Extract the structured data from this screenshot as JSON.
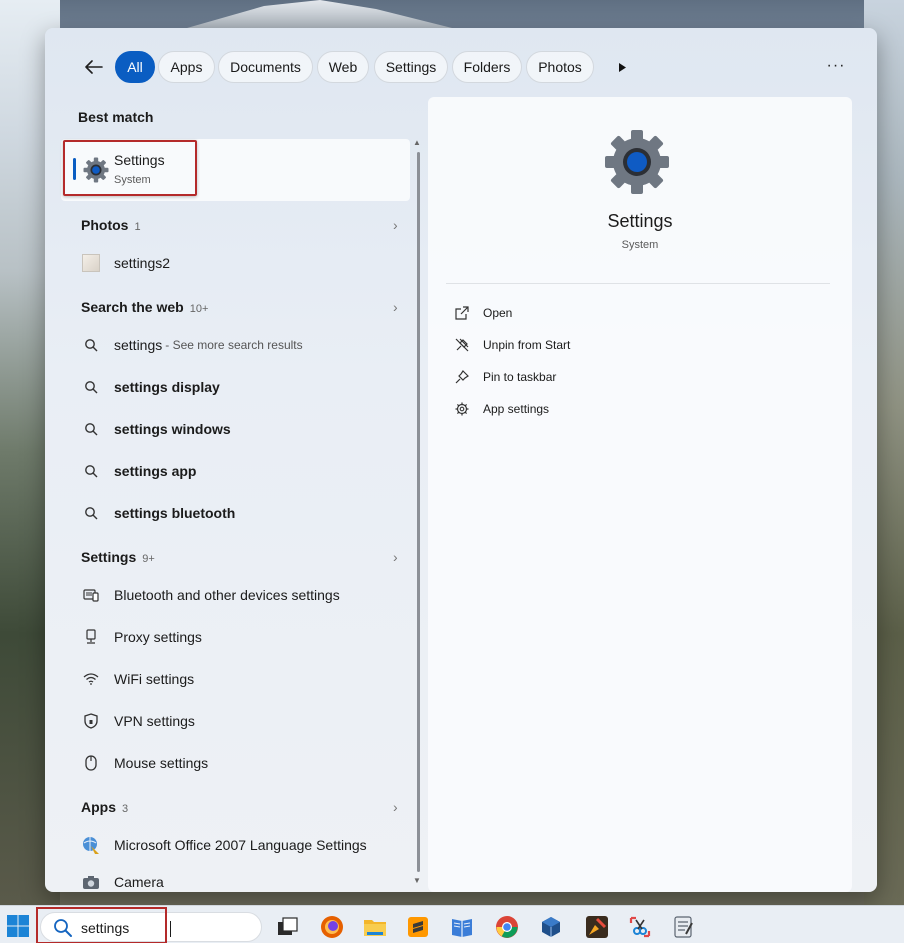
{
  "filters": {
    "back_icon": "arrow-left-icon",
    "chips": [
      {
        "label": "All",
        "active": true
      },
      {
        "label": "Apps",
        "active": false
      },
      {
        "label": "Documents",
        "active": false
      },
      {
        "label": "Web",
        "active": false
      },
      {
        "label": "Settings",
        "active": false
      },
      {
        "label": "Folders",
        "active": false
      },
      {
        "label": "Photos",
        "active": false
      }
    ],
    "more_icon": "play-right-icon",
    "overflow_icon": "ellipsis-icon"
  },
  "results": {
    "best_match": {
      "heading": "Best match",
      "name": "Settings",
      "subtitle": "System",
      "icon": "gear-icon"
    },
    "photos": {
      "heading": "Photos",
      "count": "1",
      "items": [
        {
          "label": "settings2",
          "icon": "image-thumbnail-icon"
        }
      ]
    },
    "web": {
      "heading": "Search the web",
      "count": "10+",
      "items": [
        {
          "label": "settings",
          "sub": "- See more search results",
          "bold": false
        },
        {
          "label": "settings display",
          "bold": true
        },
        {
          "label": "settings windows",
          "bold": true
        },
        {
          "label": "settings app",
          "bold": true
        },
        {
          "label": "settings bluetooth",
          "bold": true
        }
      ]
    },
    "settings": {
      "heading": "Settings",
      "count": "9+",
      "items": [
        {
          "label": "Bluetooth and other devices settings",
          "icon": "bluetooth-devices-icon"
        },
        {
          "label": "Proxy settings",
          "icon": "proxy-icon"
        },
        {
          "label": "WiFi settings",
          "icon": "wifi-icon"
        },
        {
          "label": "VPN settings",
          "icon": "shield-icon"
        },
        {
          "label": "Mouse settings",
          "icon": "mouse-icon"
        }
      ]
    },
    "apps": {
      "heading": "Apps",
      "count": "3",
      "items": [
        {
          "label": "Microsoft Office 2007 Language Settings",
          "icon": "office-language-icon"
        },
        {
          "label": "Camera",
          "icon": "camera-icon"
        }
      ]
    }
  },
  "detail": {
    "title": "Settings",
    "subtitle": "System",
    "icon": "gear-icon",
    "actions": [
      {
        "label": "Open",
        "icon": "open-external-icon"
      },
      {
        "label": "Unpin from Start",
        "icon": "unpin-icon"
      },
      {
        "label": "Pin to taskbar",
        "icon": "pin-icon"
      },
      {
        "label": "App settings",
        "icon": "gear-small-icon"
      }
    ]
  },
  "taskbar": {
    "search_value": "settings",
    "start_icon": "windows-logo-icon",
    "apps": [
      "task-view-icon",
      "firefox-icon",
      "file-explorer-icon",
      "sublime-text-icon",
      "book-app-icon",
      "chrome-icon",
      "virtualbox-icon",
      "paint-app-icon",
      "snipping-tool-icon",
      "notepad-app-icon"
    ]
  },
  "colors": {
    "accent": "#0a5dc2",
    "highlight_box": "#b42a2a",
    "panel_bg": "#e9eef5"
  }
}
